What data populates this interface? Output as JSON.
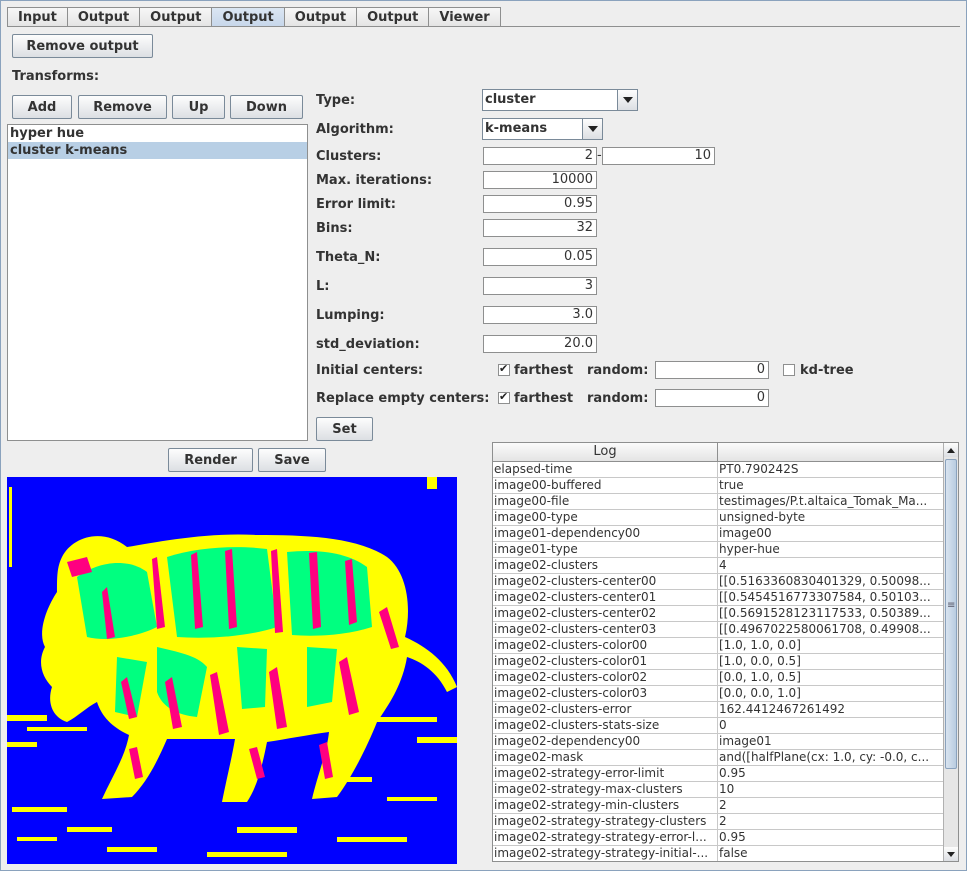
{
  "tabs": [
    "Input",
    "Output",
    "Output",
    "Output",
    "Output",
    "Output",
    "Viewer"
  ],
  "active_tab": 3,
  "remove_output_label": "Remove output",
  "transforms_label": "Transforms:",
  "transform_buttons": {
    "add": "Add",
    "remove": "Remove",
    "up": "Up",
    "down": "Down"
  },
  "transforms": [
    "hyper hue",
    "cluster k-means"
  ],
  "selected_transform": 1,
  "form": {
    "type_label": "Type:",
    "type_value": "cluster",
    "algorithm_label": "Algorithm:",
    "algorithm_value": "k-means",
    "clusters_label": "Clusters:",
    "clusters_min": "2",
    "clusters_sep": "-",
    "clusters_max": "10",
    "max_iter_label": "Max. iterations:",
    "max_iter_value": "10000",
    "error_limit_label": "Error limit:",
    "error_limit_value": "0.95",
    "bins_label": "Bins:",
    "bins_value": "32",
    "theta_label": "Theta_N:",
    "theta_value": "0.05",
    "l_label": "L:",
    "l_value": "3",
    "lumping_label": "Lumping:",
    "lumping_value": "3.0",
    "std_label": "std_deviation:",
    "std_value": "20.0",
    "initial_label": "Initial centers:",
    "initial_farthest": "farthest",
    "initial_random_label": "random:",
    "initial_random_value": "0",
    "kdtree_label": "kd-tree",
    "replace_label": "Replace empty centers:",
    "replace_farthest": "farthest",
    "replace_random_label": "random:",
    "replace_random_value": "0",
    "set_label": "Set"
  },
  "render_label": "Render",
  "save_label": "Save",
  "image_colors": {
    "background": "#0000ff",
    "cluster_yellow": "#ffff00",
    "cluster_green": "#00ff80",
    "cluster_pink": "#ff0080"
  },
  "log": {
    "header": "Log",
    "rows": [
      [
        "elapsed-time",
        "PT0.790242S"
      ],
      [
        "image00-buffered",
        "true"
      ],
      [
        "image00-file",
        "testimages/P.t.altaica_Tomak_Ma..."
      ],
      [
        "image00-type",
        "unsigned-byte"
      ],
      [
        "image01-dependency00",
        "image00"
      ],
      [
        "image01-type",
        "hyper-hue"
      ],
      [
        "image02-clusters",
        "4"
      ],
      [
        "image02-clusters-center00",
        "[[0.5163360830401329, 0.50098..."
      ],
      [
        "image02-clusters-center01",
        "[[0.5454516773307584, 0.50103..."
      ],
      [
        "image02-clusters-center02",
        "[[0.5691528123117533, 0.50389..."
      ],
      [
        "image02-clusters-center03",
        "[[0.4967022580061708, 0.49908..."
      ],
      [
        "image02-clusters-color00",
        "[1.0, 1.0, 0.0]"
      ],
      [
        "image02-clusters-color01",
        "[1.0, 0.0, 0.5]"
      ],
      [
        "image02-clusters-color02",
        "[0.0, 1.0, 0.5]"
      ],
      [
        "image02-clusters-color03",
        "[0.0, 0.0, 1.0]"
      ],
      [
        "image02-clusters-error",
        "162.4412467261492"
      ],
      [
        "image02-clusters-stats-size",
        "0"
      ],
      [
        "image02-dependency00",
        "image01"
      ],
      [
        "image02-mask",
        "and([halfPlane(cx: 1.0, cy: -0.0, c..."
      ],
      [
        "image02-strategy-error-limit",
        "0.95"
      ],
      [
        "image02-strategy-max-clusters",
        "10"
      ],
      [
        "image02-strategy-min-clusters",
        "2"
      ],
      [
        "image02-strategy-strategy-clusters",
        "2"
      ],
      [
        "image02-strategy-strategy-error-l...",
        "0.95"
      ],
      [
        "image02-strategy-strategy-initial-...",
        "false"
      ]
    ]
  }
}
